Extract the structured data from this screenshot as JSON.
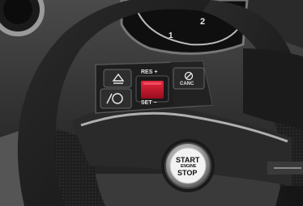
{
  "image": {
    "subject": "steering-wheel-cruise-control-and-start-stop",
    "background_color": "#ffffff"
  },
  "labels": {
    "res_plus": "RES +",
    "set_minus": "SET −",
    "cancel": "CANC",
    "start": "START",
    "engine": "ENGINE",
    "stop": "STOP"
  },
  "cluster_numbers": [
    "2",
    "1"
  ],
  "colors": {
    "selector_red": "#c8102e"
  },
  "icons": {
    "button_top": "adaptive-cruise-distance-icon",
    "button_bottom": "speed-limiter-icon",
    "cancel_button": "cruise-cancel-icon"
  }
}
